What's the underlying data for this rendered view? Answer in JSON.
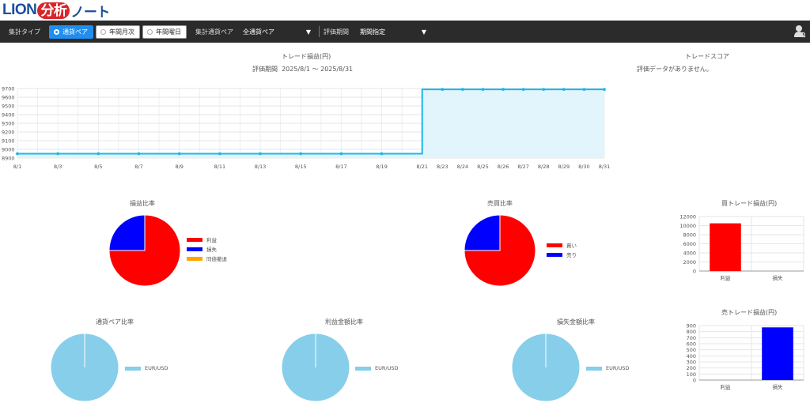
{
  "logo": {
    "lion": "LION",
    "bunseki": "分析",
    "note": "ノート"
  },
  "toolbar": {
    "aggregate_type_label": "集計タイプ",
    "buttons": [
      {
        "label": "通貨ペア",
        "active": true
      },
      {
        "label": "年間月次",
        "active": false
      },
      {
        "label": "年間曜日",
        "active": false
      }
    ],
    "pair_label": "集計通貨ペア",
    "pair_value": "全通貨ペア",
    "period_label": "評価期間",
    "period_value": "期間指定"
  },
  "trade_profit": {
    "title": "トレード損益(円)",
    "period_label": "評価期間",
    "period_value": "2025/8/1 〜 2025/8/31"
  },
  "trade_score": {
    "title": "トレードスコア",
    "message": "評価データがありません。"
  },
  "pies": {
    "pl_ratio": {
      "title": "損益比率",
      "legend": [
        "利益",
        "損失",
        "同値撤退"
      ]
    },
    "buysell_ratio": {
      "title": "売買比率",
      "legend": [
        "買い",
        "売り"
      ]
    },
    "pair_ratio": {
      "title": "通貨ペア比率",
      "legend": [
        "EUR/USD"
      ]
    },
    "profit_amount_ratio": {
      "title": "利益金額比率",
      "legend": [
        "EUR/USD"
      ]
    },
    "loss_amount_ratio": {
      "title": "損失金額比率",
      "legend": [
        "EUR/USD"
      ]
    }
  },
  "bars": {
    "buy": {
      "title": "買トレード損益(円)"
    },
    "sell": {
      "title": "売トレード損益(円)"
    }
  },
  "colors": {
    "line": "#1bb7ea",
    "fill": "#e2f4fc",
    "profit": "#ff0000",
    "loss": "#0000ff",
    "even": "#ffa500",
    "pair": "#87ceeb"
  },
  "chart_data": [
    {
      "type": "line",
      "title": "トレード損益(円)",
      "x": [
        "8/1",
        "8/2",
        "8/3",
        "8/4",
        "8/5",
        "8/6",
        "8/7",
        "8/8",
        "8/9",
        "8/10",
        "8/11",
        "8/12",
        "8/13",
        "8/14",
        "8/15",
        "8/16",
        "8/17",
        "8/18",
        "8/19",
        "8/20",
        "8/21",
        "8/23",
        "8/24",
        "8/25",
        "8/26",
        "8/27",
        "8/28",
        "8/29",
        "8/30",
        "8/31"
      ],
      "xticks": [
        "8/1",
        "8/3",
        "8/5",
        "8/7",
        "8/9",
        "8/11",
        "8/13",
        "8/15",
        "8/17",
        "8/19",
        "8/21",
        "8/23",
        "8/24",
        "8/25",
        "8/26",
        "8/27",
        "8/28",
        "8/29",
        "8/30",
        "8/31"
      ],
      "markers": [
        "8/1",
        "8/3",
        "8/5",
        "8/7",
        "8/9",
        "8/11",
        "8/13",
        "8/15",
        "8/17",
        "8/19",
        "8/23",
        "8/24",
        "8/25",
        "8/26",
        "8/27",
        "8/28",
        "8/29",
        "8/30",
        "8/31"
      ],
      "y": [
        8950,
        8950,
        8950,
        8950,
        8950,
        8950,
        8950,
        8950,
        8950,
        8950,
        8950,
        8950,
        8950,
        8950,
        8950,
        8950,
        8950,
        8950,
        8950,
        8950,
        9690,
        9690,
        9690,
        9690,
        9690,
        9690,
        9690,
        9690,
        9690,
        9690
      ],
      "ylim": [
        8900,
        9700
      ],
      "yticks": [
        8900,
        9000,
        9100,
        9200,
        9300,
        9400,
        9500,
        9600,
        9700
      ],
      "grid": true
    },
    {
      "type": "pie",
      "title": "損益比率",
      "labels": [
        "利益",
        "損失",
        "同値撤退"
      ],
      "values": [
        75,
        25,
        0
      ]
    },
    {
      "type": "pie",
      "title": "売買比率",
      "labels": [
        "買い",
        "売り"
      ],
      "values": [
        75,
        25
      ]
    },
    {
      "type": "bar",
      "title": "買トレード損益(円)",
      "categories": [
        "利益",
        "損失"
      ],
      "values": [
        10500,
        0
      ],
      "ylim": [
        0,
        12000
      ],
      "yticks": [
        0,
        2000,
        4000,
        6000,
        8000,
        10000,
        12000
      ]
    },
    {
      "type": "pie",
      "title": "通貨ペア比率",
      "labels": [
        "EUR/USD"
      ],
      "values": [
        100
      ]
    },
    {
      "type": "pie",
      "title": "利益金額比率",
      "labels": [
        "EUR/USD"
      ],
      "values": [
        100
      ]
    },
    {
      "type": "pie",
      "title": "損失金額比率",
      "labels": [
        "EUR/USD"
      ],
      "values": [
        100
      ]
    },
    {
      "type": "bar",
      "title": "売トレード損益(円)",
      "categories": [
        "利益",
        "損失"
      ],
      "values": [
        0,
        870
      ],
      "ylim": [
        0,
        900
      ],
      "yticks": [
        0,
        100,
        200,
        300,
        400,
        500,
        600,
        700,
        800,
        900
      ]
    }
  ]
}
